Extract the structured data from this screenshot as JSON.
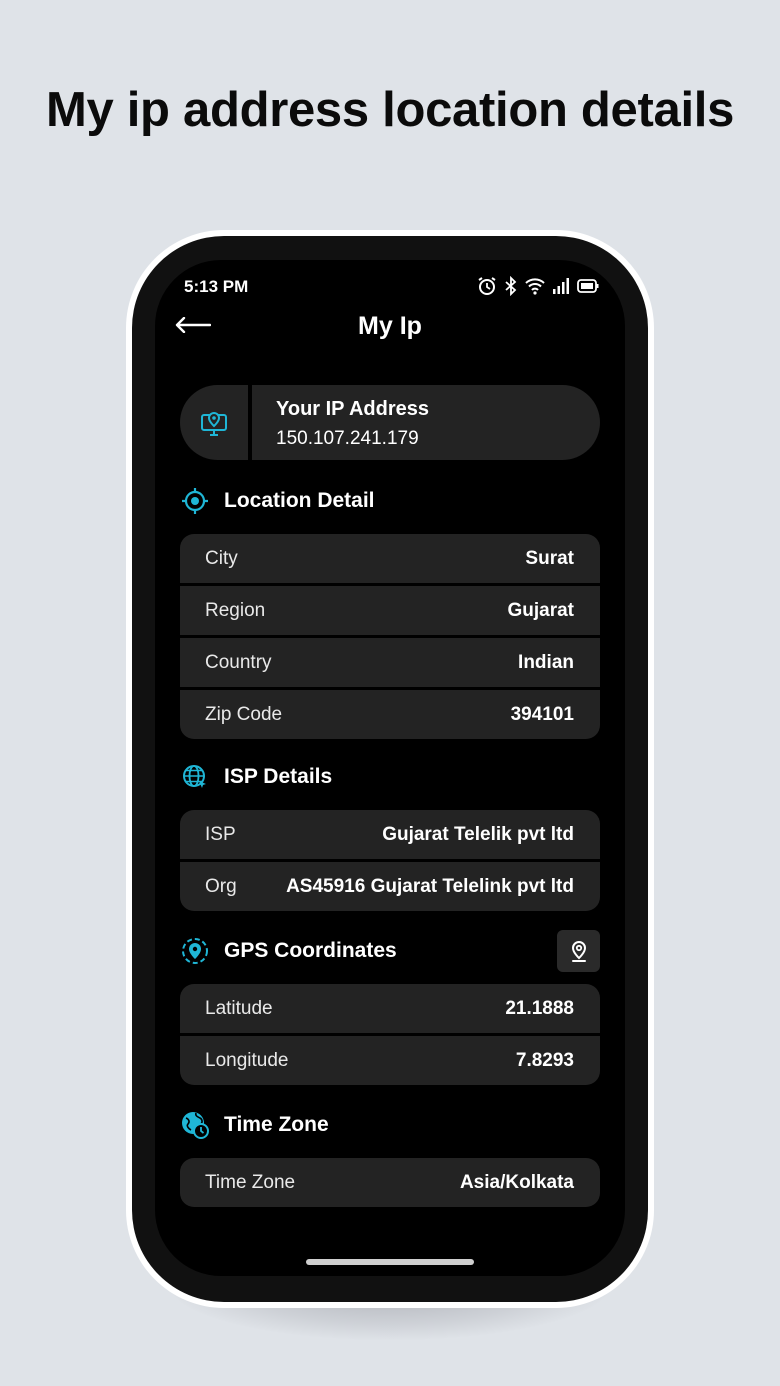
{
  "headline": "My ip address location details",
  "status_bar": {
    "time": "5:13 PM"
  },
  "header": {
    "title": "My Ip"
  },
  "ip_card": {
    "label": "Your IP Address",
    "value": "150.107.241.179"
  },
  "location": {
    "title": "Location Detail",
    "rows": [
      {
        "label": "City",
        "value": "Surat"
      },
      {
        "label": "Region",
        "value": "Gujarat"
      },
      {
        "label": "Country",
        "value": "Indian"
      },
      {
        "label": "Zip Code",
        "value": "394101"
      }
    ]
  },
  "isp": {
    "title": "ISP Details",
    "rows": [
      {
        "label": "ISP",
        "value": "Gujarat Telelik pvt ltd"
      },
      {
        "label": "Org",
        "value": "AS45916 Gujarat Telelink pvt ltd"
      }
    ]
  },
  "gps": {
    "title": "GPS Coordinates",
    "rows": [
      {
        "label": "Latitude",
        "value": "21.1888"
      },
      {
        "label": "Longitude",
        "value": "7.8293"
      }
    ]
  },
  "timezone": {
    "title": "Time Zone",
    "rows": [
      {
        "label": "Time Zone",
        "value": "Asia/Kolkata"
      }
    ]
  },
  "colors": {
    "accent": "#1fb6d6",
    "card": "#232323",
    "screen": "#000000",
    "page": "#dfe3e8"
  },
  "icons": [
    "back-arrow-icon",
    "ip-monitor-icon",
    "location-target-icon",
    "globe-icon",
    "gps-pin-icon",
    "map-pin-icon",
    "timezone-globe-icon",
    "alarm-icon",
    "bluetooth-icon",
    "wifi-icon",
    "signal-icon",
    "battery-icon"
  ]
}
